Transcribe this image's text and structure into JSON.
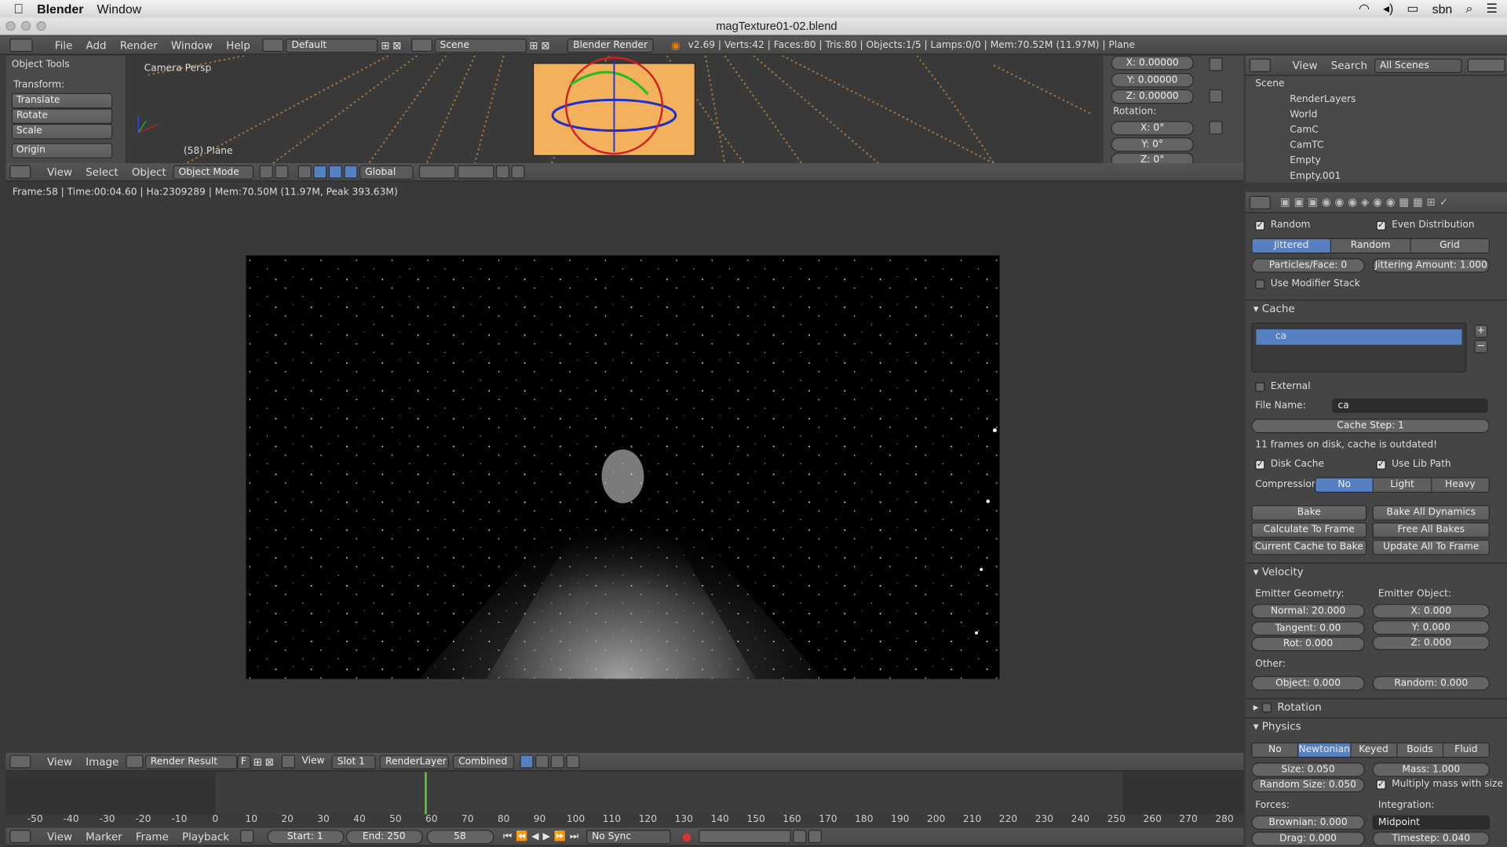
{
  "macmenu": {
    "app": "Blender",
    "window": "Window",
    "user": "sbn"
  },
  "window_title": "magTexture01-02.blend",
  "info_header": {
    "menus": [
      "File",
      "Add",
      "Render",
      "Window",
      "Help"
    ],
    "layout": "Default",
    "scene": "Scene",
    "engine": "Blender Render",
    "stats": "v2.69 | Verts:42 | Faces:80 | Tris:80 | Objects:1/5 | Lamps:0/0 | Mem:70.52M (11.97M) | Plane"
  },
  "tools": {
    "title": "Object Tools",
    "transform": "Transform:",
    "buttons": [
      "Translate",
      "Rotate",
      "Scale"
    ],
    "origin": "Origin"
  },
  "viewport": {
    "label": "Camera Persp",
    "object": "(58) Plane",
    "menus": [
      "View",
      "Select",
      "Object"
    ],
    "mode": "Object Mode",
    "orientation": "Global"
  },
  "npanel": {
    "location": [
      "X: 0.00000",
      "Y: 0.00000",
      "Z: 0.00000"
    ],
    "rotation_label": "Rotation:",
    "rotation": [
      "X: 0°",
      "Y: 0°",
      "Z: 0°"
    ]
  },
  "outliner": {
    "menus": [
      "View",
      "Search"
    ],
    "filter": "All Scenes",
    "items": [
      "Scene",
      "RenderLayers",
      "World",
      "CamC",
      "CamTC",
      "Empty",
      "Empty.001"
    ]
  },
  "render": {
    "status": "Frame:58 | Time:00:04.60 | Ha:2309289 | Mem:70.50M (11.97M, Peak 393.63M)",
    "menus": [
      "View",
      "Image"
    ],
    "image": "Render Result",
    "f": "F",
    "view": "View",
    "slot": "Slot 1",
    "layer": "RenderLayer",
    "pass": "Combined"
  },
  "props": {
    "random": "Random",
    "even": "Even Distribution",
    "dist": [
      "Jittered",
      "Random",
      "Grid"
    ],
    "ppf": "Particles/Face: 0",
    "jit": "Jittering Amount: 1.000",
    "modstack": "Use Modifier Stack",
    "cache_title": "Cache",
    "cache_item": "ca",
    "external": "External",
    "filename_label": "File Name:",
    "filename": "ca",
    "cachestep": "Cache Step: 1",
    "cache_info": "11 frames on disk, cache is outdated!",
    "diskcache": "Disk Cache",
    "libpath": "Use Lib Path",
    "compression": "Compression",
    "comp": [
      "No",
      "Light",
      "Heavy"
    ],
    "bake": [
      "Bake",
      "Bake All Dynamics",
      "Calculate To Frame",
      "Free All Bakes",
      "Current Cache to Bake",
      "Update All To Frame"
    ],
    "velocity": "Velocity",
    "emgeo": "Emitter Geometry:",
    "emobj": "Emitter Object:",
    "normal": "Normal: 20.000",
    "tangent": "Tangent: 0.00",
    "rot": "Rot: 0.000",
    "vx": "X: 0.000",
    "vy": "Y: 0.000",
    "vz": "Z: 0.000",
    "other": "Other:",
    "object": "Object: 0.000",
    "vrandom": "Random: 0.000",
    "rotation": "Rotation",
    "physics": "Physics",
    "phys": [
      "No",
      "Newtonian",
      "Keyed",
      "Boids",
      "Fluid"
    ],
    "size": "Size: 0.050",
    "mass": "Mass: 1.000",
    "randsize": "Random Size: 0.050",
    "multmass": "Multiply mass with size",
    "forces": "Forces:",
    "integration": "Integration:",
    "brownian": "Brownian: 0.000",
    "midpoint": "Midpoint",
    "drag": "Drag: 0.000",
    "timestep": "Timestep: 0.040"
  },
  "timeline": {
    "ticks": [
      "-50",
      "-40",
      "-30",
      "-20",
      "-10",
      "0",
      "10",
      "20",
      "30",
      "40",
      "50",
      "60",
      "70",
      "80",
      "90",
      "100",
      "110",
      "120",
      "130",
      "140",
      "150",
      "160",
      "170",
      "180",
      "190",
      "200",
      "210",
      "220",
      "230",
      "240",
      "250",
      "260",
      "270",
      "280"
    ],
    "current_frame": 58,
    "menus": [
      "View",
      "Marker",
      "Frame",
      "Playback"
    ],
    "start": "Start: 1",
    "end": "End: 250",
    "frame": "58",
    "sync": "No Sync"
  }
}
